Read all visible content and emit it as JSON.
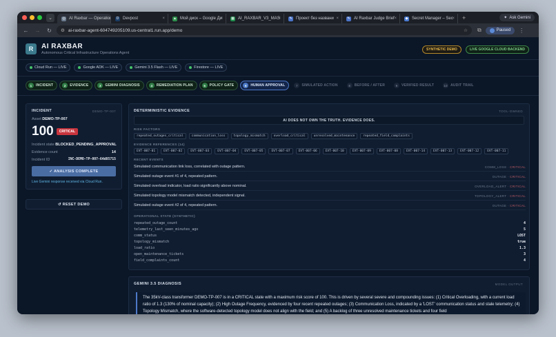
{
  "browser": {
    "tabs": [
      {
        "title": "AI Raxbar — Operation",
        "active": true,
        "fav": "◎",
        "color": "#6a7a8c"
      },
      {
        "title": "Devpost",
        "active": false,
        "fav": "D",
        "color": "#1b3c63"
      },
      {
        "title": "Мой диск – Google Ди",
        "active": false,
        "fav": "▲",
        "color": "#2f8f4e"
      },
      {
        "title": "AI_RAXBAR_V3_MAS",
        "active": false,
        "fav": "▦",
        "color": "#1f8a4c"
      },
      {
        "title": "Проект без названи",
        "active": false,
        "fav": "✎",
        "color": "#4b74c9"
      },
      {
        "title": "AI Raxbar Judge Brief",
        "active": false,
        "fav": "✎",
        "color": "#4b74c9"
      },
      {
        "title": "Secret Manager – Sec",
        "active": false,
        "fav": "◆",
        "color": "#4a7bd0"
      }
    ],
    "new_tab": "+",
    "ask_gemini": "Ask Gemini",
    "url": "ai-raxbar-agent-604749205109.us-central1.run.app/demo",
    "profile": "Paused"
  },
  "app": {
    "logo_letter": "R",
    "title": "AI RAXBAR",
    "subtitle": "Autonomous Critical Infrastructure Operations Agent",
    "badge_synthetic": "SYNTHETIC DEMO",
    "badge_live": "LIVE GOOGLE CLOUD BACKEND",
    "pills": [
      "Cloud Run — LIVE",
      "Google ADK — LIVE",
      "Gemini 3.5 Flash — LIVE",
      "Firestore — LIVE"
    ],
    "steps": [
      {
        "n": "1",
        "label": "INCIDENT",
        "state": "done"
      },
      {
        "n": "2",
        "label": "EVIDENCE",
        "state": "done"
      },
      {
        "n": "3",
        "label": "GEMINI DIAGNOSIS",
        "state": "done"
      },
      {
        "n": "4",
        "label": "REMEDIATION PLAN",
        "state": "done"
      },
      {
        "n": "5",
        "label": "POLICY GATE",
        "state": "done"
      },
      {
        "n": "6",
        "label": "HUMAN APPROVAL",
        "state": "current"
      },
      {
        "n": "7",
        "label": "SIMULATED ACTION",
        "state": "pending"
      },
      {
        "n": "8",
        "label": "BEFORE / AFTER",
        "state": "pending"
      },
      {
        "n": "9",
        "label": "VERIFIED RESULT",
        "state": "pending"
      },
      {
        "n": "10",
        "label": "AUDIT TRAIL",
        "state": "pending"
      }
    ]
  },
  "incident": {
    "title": "INCIDENT",
    "id_right": "DEMO-TP-007",
    "asset_label": "Asset",
    "asset_value": "DEMO-TP-007",
    "score": "100",
    "severity": "CRITICAL",
    "state_label": "Incident state",
    "state_value": "BLOCKED_PENDING_APPROVAL",
    "evidence_label": "Evidence count",
    "evidence_value": "14",
    "iid_label": "Incident ID",
    "iid_value": "INC-DEMO-TP-007-64d85715",
    "analysis_button": "✓ ANALYSIS COMPLETE",
    "gemini_note": "Live Gemini response received via Cloud Run.",
    "reset_button": "↺ RESET DEMO"
  },
  "evidence": {
    "title": "DETERMINISTIC EVIDENCE",
    "right": "TOOL-OWNED",
    "banner": "AI DOES NOT OWN THE TRUTH. EVIDENCE DOES.",
    "risk_title": "RISK FACTORS",
    "risk_factors": [
      "repeated_outages_critical",
      "communication_loss",
      "topology_mismatch",
      "overload_critical",
      "unresolved_maintenance",
      "repeated_field_complaints"
    ],
    "refs_title": "EVIDENCE REFERENCES (14)",
    "refs": [
      "EVT-007-01",
      "EVT-007-02",
      "EVT-007-03",
      "EVT-007-04",
      "EVT-007-05",
      "EVT-007-07",
      "EVT-007-06",
      "EVT-007-10",
      "EVT-007-09",
      "EVT-007-08",
      "EVT-007-14",
      "EVT-007-13",
      "EVT-007-12",
      "EVT-007-11"
    ],
    "recent_title": "RECENT EVENTS",
    "events": [
      {
        "desc": "Simulated communication link loss, correlated with outage pattern.",
        "type": "COMM_LOSS",
        "sev": "CRITICAL"
      },
      {
        "desc": "Simulated outage event #1 of 4, repeated pattern.",
        "type": "OUTAGE",
        "sev": "CRITICAL"
      },
      {
        "desc": "Simulated overload indicator, load ratio significantly above nominal.",
        "type": "OVERLOAD_ALERT",
        "sev": "CRITICAL"
      },
      {
        "desc": "Simulated topology model mismatch detected, independent signal.",
        "type": "TOPOLOGY_ALERT",
        "sev": "CRITICAL"
      },
      {
        "desc": "Simulated outage event #2 of 4, repeated pattern.",
        "type": "OUTAGE",
        "sev": "CRITICAL"
      }
    ],
    "ops_title": "OPERATIONAL STATE (SYNTHETIC)",
    "ops": [
      {
        "k": "repeated_outage_count",
        "v": "4"
      },
      {
        "k": "telemetry_last_seen_minutes_ago",
        "v": "5"
      },
      {
        "k": "comm_status",
        "v": "LOST"
      },
      {
        "k": "topology_mismatch",
        "v": "true"
      },
      {
        "k": "load_ratio",
        "v": "1.3"
      },
      {
        "k": "open_maintenance_tickets",
        "v": "3"
      },
      {
        "k": "field_complaints_count",
        "v": "4"
      }
    ]
  },
  "diagnosis": {
    "title": "GEMINI 3.5 DIAGNOSIS",
    "right": "MODEL OUTPUT",
    "text": "The 35kV-class transformer DEMO-TP-007 is in a CRITICAL state with a maximum risk score of 100. This is driven by several severe and compounding issues: (1) Critical Overloading, with a current load ratio of 1.3 (130% of nominal capacity); (2) High Outage Frequency, evidenced by four recent repeated outages; (3) Communication Loss, indicated by a 'LOST' communication status and stale telemetry; (4) Topology Mismatch, where the software-detected topology model does not align with the field; and (5) A backlog of three unresolved maintenance tickets and four field"
  },
  "colors": {
    "critical": "#c8343d",
    "live": "#46c46a",
    "accent": "#4e79c8"
  }
}
